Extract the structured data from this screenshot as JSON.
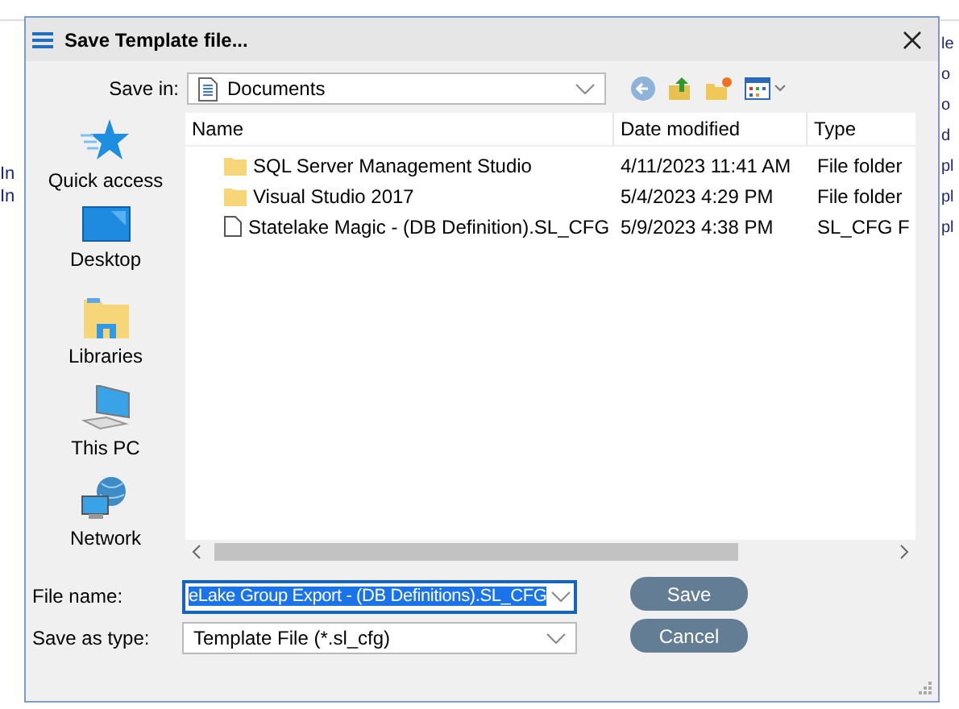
{
  "background": {
    "left_fragments": [
      "In",
      "In"
    ],
    "right_fragments": [
      "le",
      "o",
      "o",
      "d",
      "pl",
      "pl",
      "pl"
    ]
  },
  "window": {
    "title": "Save Template file..."
  },
  "save_in": {
    "label": "Save in:",
    "value": "Documents"
  },
  "places": [
    {
      "label": "Quick access",
      "kind": "star"
    },
    {
      "label": "Desktop",
      "kind": "desktop"
    },
    {
      "label": "Libraries",
      "kind": "library"
    },
    {
      "label": "This PC",
      "kind": "pc"
    },
    {
      "label": "Network",
      "kind": "network"
    }
  ],
  "table": {
    "columns": [
      "Name",
      "Date modified",
      "Type"
    ],
    "rows": [
      {
        "kind": "folder",
        "name": "SQL Server Management Studio",
        "date": "4/11/2023 11:41 AM",
        "type": "File folder"
      },
      {
        "kind": "folder",
        "name": "Visual Studio 2017",
        "date": "5/4/2023 4:29 PM",
        "type": "File folder"
      },
      {
        "kind": "file",
        "name": "Statelake Magic - (DB Definition).SL_CFG",
        "date": "5/9/2023 4:38 PM",
        "type": "SL_CFG F"
      }
    ]
  },
  "file_name": {
    "label": "File name:",
    "value": "eLake Group Export - (DB Definitions).SL_CFG"
  },
  "save_as_type": {
    "label": "Save as type:",
    "value": "Template File (*.sl_cfg)"
  },
  "buttons": [
    "Save",
    "Cancel"
  ]
}
